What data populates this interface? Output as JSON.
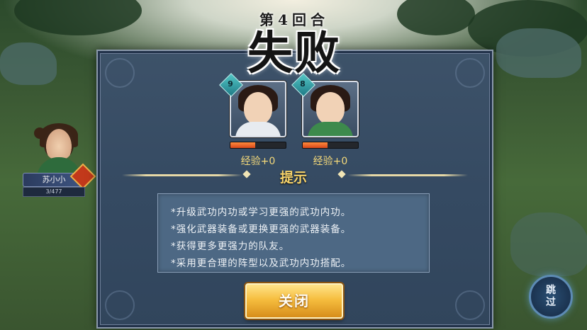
{
  "header": {
    "round_label": "第4回合",
    "result_title": "失败"
  },
  "heroes": [
    {
      "level": "9",
      "exp_label": "经验+0",
      "exp_fill": 0.45,
      "robe_color": "#e7ebf0"
    },
    {
      "level": "8",
      "exp_label": "经验+0",
      "exp_fill": 0.45,
      "robe_color": "#3d8a4c"
    }
  ],
  "player": {
    "name": "苏小小",
    "hp_text": "3/477"
  },
  "tips": {
    "title": "提示",
    "items": [
      "*升级武功内功或学习更强的武功内功。",
      "*强化武器装备或更换更强的武器装备。",
      "*获得更多更强力的队友。",
      "*采用更合理的阵型以及武功内功搭配。"
    ]
  },
  "buttons": {
    "close_label": "关闭",
    "skip_label": "跳过"
  },
  "colors": {
    "panel": "#354a62",
    "accent_gold": "#f7d36a",
    "exp_fill": "#ff8a3c"
  }
}
